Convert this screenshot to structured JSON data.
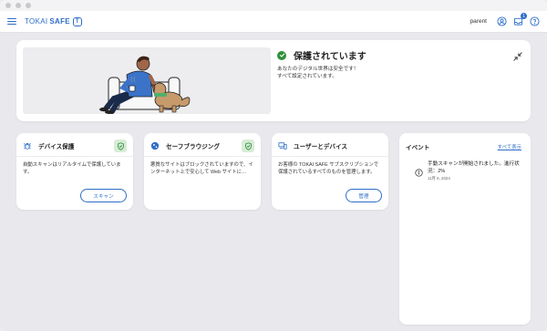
{
  "app": {
    "brand_light": "TOKAI",
    "brand_bold": "SAFE",
    "brand_badge": "T"
  },
  "header": {
    "user": "parent",
    "notification_count": "1"
  },
  "hero": {
    "status_title": "保護されています",
    "status_lines": [
      "あなたのデジタル世界は安全です！",
      "すべて設定されています。"
    ]
  },
  "cards": [
    {
      "title": "デバイス保護",
      "body": "自動スキャンはリアルタイムで保護しています。",
      "button": "スキャン",
      "icon": "bug-icon"
    },
    {
      "title": "セーフブラウジング",
      "body": "悪質なサイトはブロックされていますので、インターネット上で安心して Web サイトに…",
      "icon": "globe-icon"
    },
    {
      "title": "ユーザーとデバイス",
      "body": "お客様の TOKAI SAFE サブスクリプションで保護されているすべてのものを管理します。",
      "button": "管理",
      "icon": "devices-icon"
    }
  ],
  "events": {
    "title": "イベント",
    "see_all": "すべて表示",
    "items": [
      {
        "text": "手動スキャンが開始されました。進行状況：2%",
        "time": "11月 6, 2024"
      }
    ]
  },
  "colors": {
    "accent": "#2f6ec7",
    "success": "#2f8f3a",
    "shield_badge_bg": "#d7ecd6",
    "app_bg": "#e9e8ec"
  }
}
